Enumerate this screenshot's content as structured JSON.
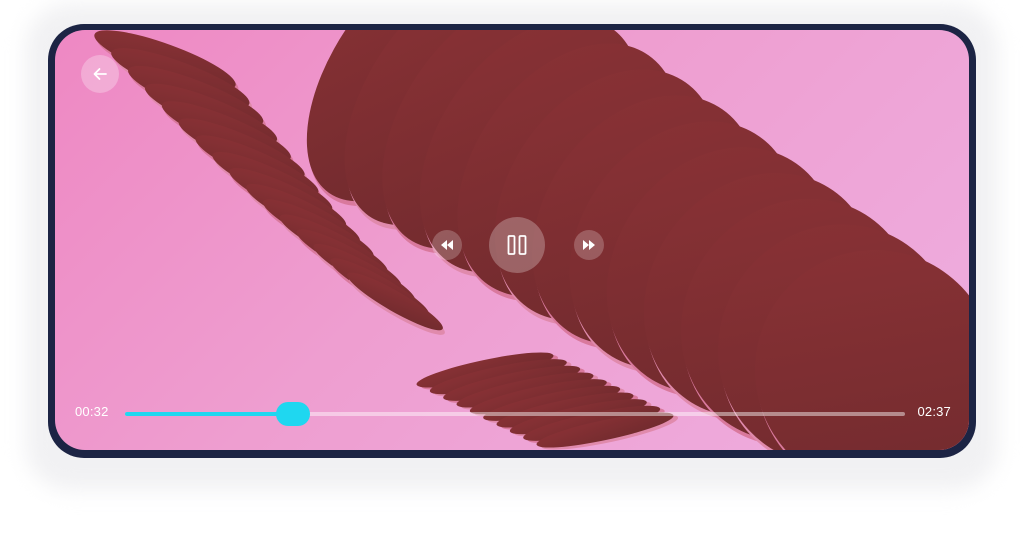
{
  "player": {
    "current_time": "00:32",
    "total_time": "02:37",
    "progress_fraction": 0.215,
    "state": "playing"
  },
  "icons": {
    "back": "arrow-left-icon",
    "rewind": "rewind-icon",
    "pause": "pause-icon",
    "forward": "fast-forward-icon"
  },
  "colors": {
    "accent": "#1fd7f0",
    "frame": "#1c2444",
    "background_pink": "#ee9ed0",
    "coil": "#7a2e30"
  }
}
